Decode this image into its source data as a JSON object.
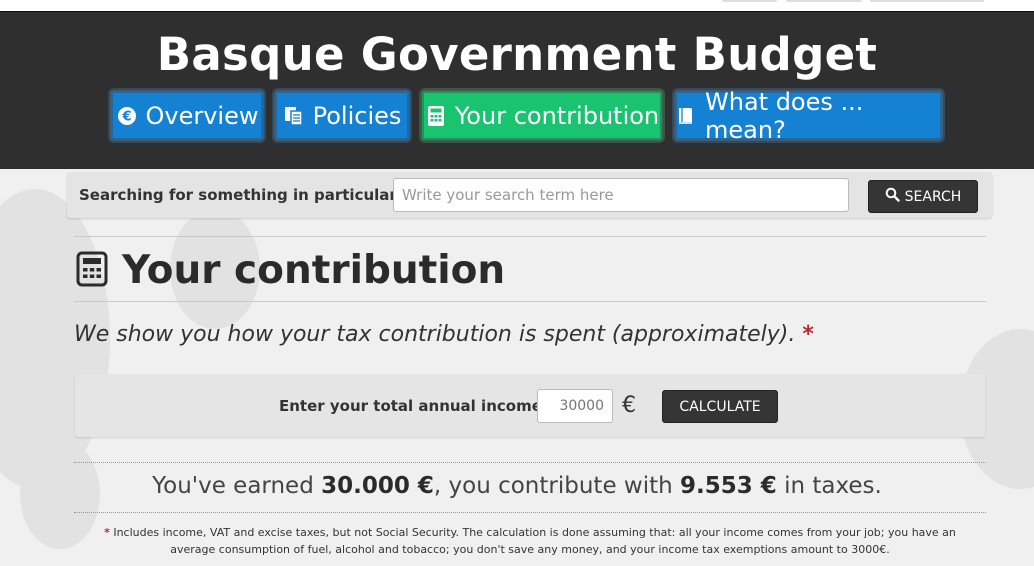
{
  "site": {
    "title": "Basque Government Budget"
  },
  "nav": {
    "items": [
      {
        "label": "Overview",
        "icon": "euro-icon",
        "active": false
      },
      {
        "label": "Policies",
        "icon": "documents-icon",
        "active": false
      },
      {
        "label": "Your contribution",
        "icon": "calculator-icon",
        "active": true
      },
      {
        "label": "What does ... mean?",
        "icon": "book-icon",
        "active": false
      }
    ]
  },
  "search": {
    "label": "Searching for something in particular?",
    "placeholder": "Write your search term here",
    "button_label": "SEARCH"
  },
  "page": {
    "title": "Your contribution",
    "subtitle": "We show you how your tax contribution is spent (approximately).",
    "asterisk": "*"
  },
  "calculator": {
    "label": "Enter your total annual income",
    "income_placeholder": "30000",
    "currency": "€",
    "button_label": "CALCULATE"
  },
  "result": {
    "prefix": "You've earned",
    "earned": "30.000 €",
    "middle": ", you contribute with",
    "taxes": "9.553 €",
    "suffix": "in taxes."
  },
  "footnote": {
    "asterisk": "*",
    "text": "Includes income, VAT and excise taxes, but not Social Security. The calculation is done assuming that: all your income comes from your job; you have an average consumption of fuel, alcohol and tobacco; you don't save any money, and your income tax exemptions amount to 3000€."
  },
  "colors": {
    "header_bg": "#2f2f2f",
    "nav_blue": "#1581d3",
    "nav_active_green": "#19c370",
    "dark_button": "#353535",
    "accent_red": "#c0262d"
  }
}
